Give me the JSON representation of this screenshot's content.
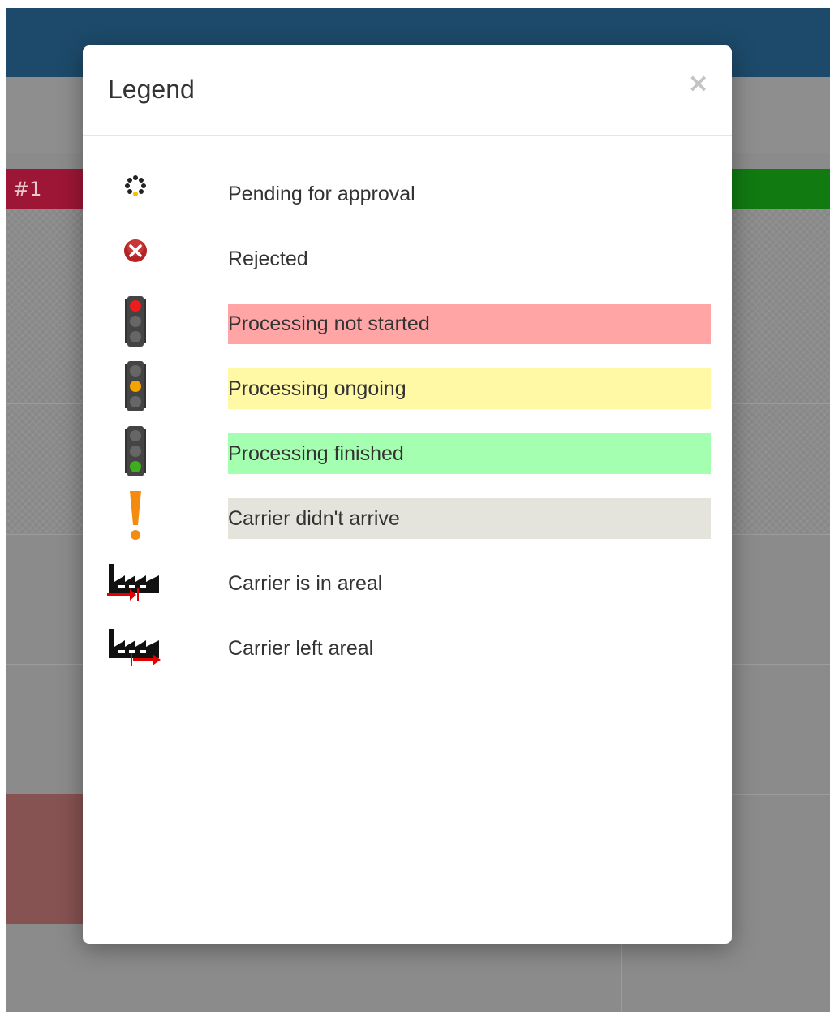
{
  "background": {
    "row_label": "#1"
  },
  "modal": {
    "title": "Legend",
    "close_label": "×",
    "items": [
      {
        "label": "Pending for approval",
        "icon": "spinner-icon",
        "highlight": ""
      },
      {
        "label": "Rejected",
        "icon": "rejected-icon",
        "highlight": ""
      },
      {
        "label": "Processing not started",
        "icon": "traffic-light-red-icon",
        "highlight": "#ffa5a5"
      },
      {
        "label": "Processing ongoing",
        "icon": "traffic-light-yellow-icon",
        "highlight": "#fff8a5"
      },
      {
        "label": "Processing finished",
        "icon": "traffic-light-green-icon",
        "highlight": "#a5ffb1"
      },
      {
        "label": "Carrier didn't arrive",
        "icon": "exclamation-icon",
        "highlight": "#e5e4dc"
      },
      {
        "label": "Carrier is in areal",
        "icon": "factory-arrival-icon",
        "highlight": ""
      },
      {
        "label": "Carrier left areal",
        "icon": "factory-departure-icon",
        "highlight": ""
      }
    ]
  },
  "colors": {
    "header_bar": "#1d4a6a",
    "overlay": "#8b8b8b",
    "status_red": "#9d1635",
    "status_green": "#117a11"
  }
}
